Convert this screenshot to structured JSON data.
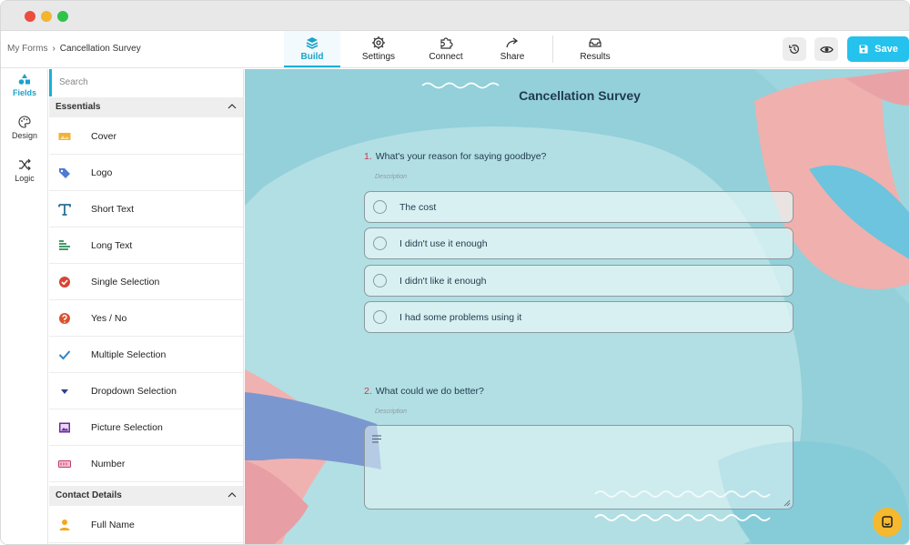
{
  "window": {
    "controls": [
      "close",
      "minimize",
      "maximize"
    ]
  },
  "breadcrumb": {
    "root": "My Forms",
    "separator": "›",
    "current": "Cancellation Survey"
  },
  "nav": {
    "tabs": [
      {
        "label": "Build",
        "icon": "layers-icon",
        "active": true
      },
      {
        "label": "Settings",
        "icon": "gear-icon",
        "active": false
      },
      {
        "label": "Connect",
        "icon": "puzzle-icon",
        "active": false
      },
      {
        "label": "Share",
        "icon": "share-arrow-icon",
        "active": false
      },
      {
        "label": "Results",
        "icon": "inbox-icon",
        "active": false
      }
    ]
  },
  "toolbar": {
    "history_icon": "history-icon",
    "preview_icon": "eye-icon",
    "save_label": "Save",
    "save_color": "#24c2ec"
  },
  "rail": {
    "items": [
      {
        "label": "Fields",
        "icon": "shapes-icon",
        "active": true
      },
      {
        "label": "Design",
        "icon": "palette-icon",
        "active": false
      },
      {
        "label": "Logic",
        "icon": "shuffle-icon",
        "active": false
      }
    ]
  },
  "panel": {
    "search_placeholder": "Search",
    "sections": [
      {
        "title": "Essentials",
        "items": [
          {
            "label": "Cover",
            "icon": "cover-icon"
          },
          {
            "label": "Logo",
            "icon": "tag-icon"
          },
          {
            "label": "Short Text",
            "icon": "text-t-icon"
          },
          {
            "label": "Long Text",
            "icon": "paragraph-icon"
          },
          {
            "label": "Single Selection",
            "icon": "check-circle-icon"
          },
          {
            "label": "Yes / No",
            "icon": "yes-no-icon"
          },
          {
            "label": "Multiple Selection",
            "icon": "checkmark-icon"
          },
          {
            "label": "Dropdown Selection",
            "icon": "caret-down-icon"
          },
          {
            "label": "Picture Selection",
            "icon": "picture-icon"
          },
          {
            "label": "Number",
            "icon": "number-icon"
          }
        ]
      },
      {
        "title": "Contact Details",
        "items": [
          {
            "label": "Full Name",
            "icon": "person-icon"
          }
        ]
      }
    ]
  },
  "form": {
    "title": "Cancellation Survey",
    "questions": [
      {
        "number": "1.",
        "text": "What's your reason for saying goodbye?",
        "description": "Description",
        "options": [
          "The cost",
          "I didn't use it enough",
          "I didn't like it enough",
          "I had some problems using it"
        ]
      },
      {
        "number": "2.",
        "text": "What could we do better?",
        "description": "Description"
      }
    ]
  },
  "colors": {
    "accent": "#1ab0d6",
    "canvas_bg": "#93d0d9",
    "question_number": "#d6344d",
    "chat_button": "#f5b82e"
  }
}
